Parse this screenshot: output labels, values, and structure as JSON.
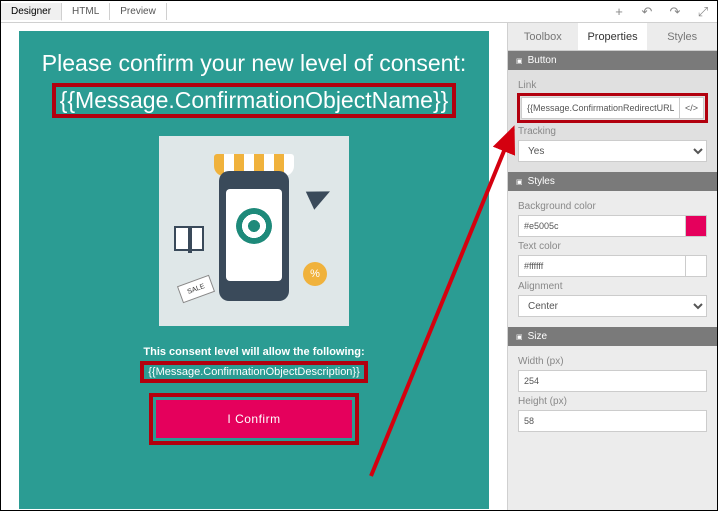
{
  "top_tabs": {
    "designer": "Designer",
    "html": "HTML",
    "preview": "Preview"
  },
  "canvas": {
    "heading": "Please confirm your new level of consent:",
    "token_name": "{{Message.ConfirmationObjectName}}",
    "consent_label": "This consent level will allow the following:",
    "token_desc": "{{Message.ConfirmationObjectDescription}}",
    "confirm_label": "I Confirm",
    "sale_text": "SALE"
  },
  "panel": {
    "tabs": {
      "toolbox": "Toolbox",
      "properties": "Properties",
      "styles": "Styles"
    },
    "button_section": "Button",
    "link_label": "Link",
    "link_value": "{{Message.ConfirmationRedirectURL}}",
    "code_icon": "</>",
    "tracking_label": "Tracking",
    "tracking_value": "Yes",
    "styles_section": "Styles",
    "bg_label": "Background color",
    "bg_value": "#e5005c",
    "text_color_label": "Text color",
    "text_color_value": "#ffffff",
    "alignment_label": "Alignment",
    "alignment_value": "Center",
    "size_section": "Size",
    "width_label": "Width (px)",
    "width_value": "254",
    "height_label": "Height (px)",
    "height_value": "58"
  }
}
